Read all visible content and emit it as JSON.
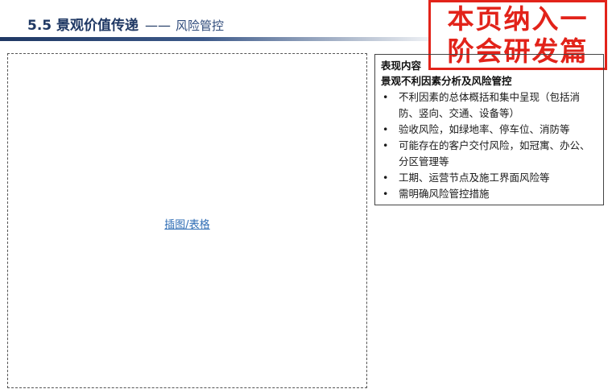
{
  "header": {
    "title": "5.5 景观价值传递",
    "dash": "——",
    "subtitle": "风险管控"
  },
  "stamp": {
    "line1": "本页纳入一",
    "line2": "阶会研发篇",
    "color": "#e2231a"
  },
  "placeholder": {
    "link_text": "插图/表格"
  },
  "content": {
    "heading": "表现内容",
    "subheading": "景观不利因素分析及风险管控",
    "items": [
      "不利因素的总体概括和集中呈现（包括消防、竖向、交通、设备等）",
      "验收风险，如绿地率、停车位、消防等",
      "可能存在的客户交付风险，如冠寓、办公、分区管理等",
      "工期、运营节点及施工界面风险等",
      " 需明确风险管控措施"
    ]
  },
  "colors": {
    "title": "#1f3864",
    "link": "#2f6db5"
  }
}
